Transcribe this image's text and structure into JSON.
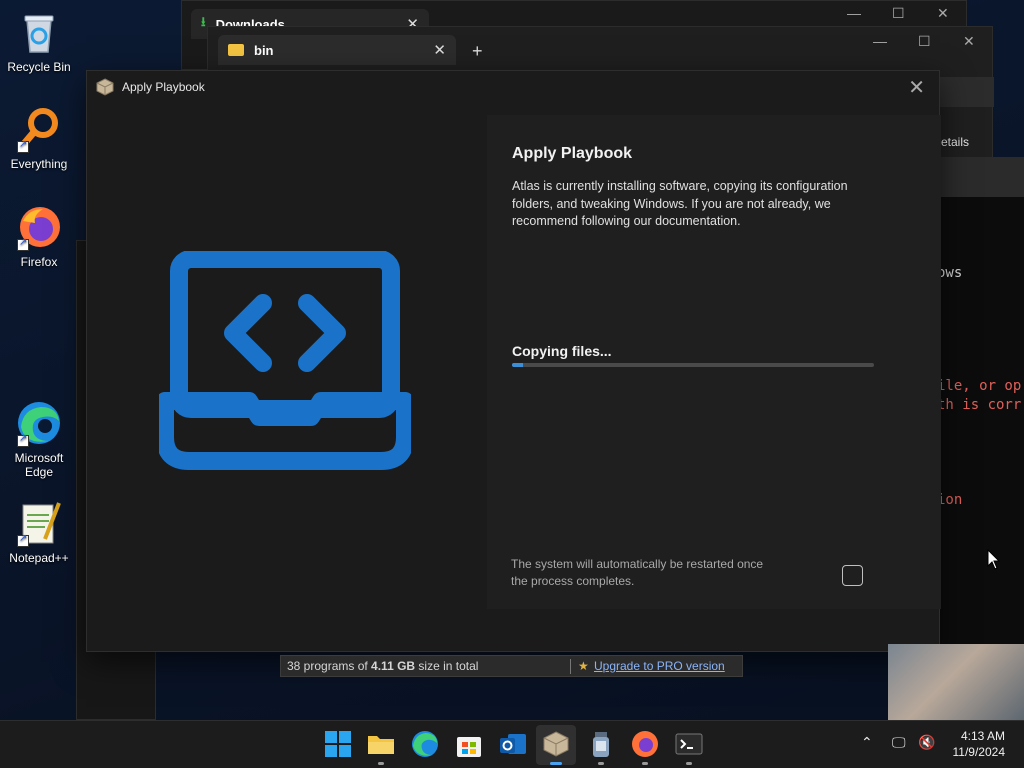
{
  "desktop": {
    "icons": [
      {
        "label": "Recycle Bin"
      },
      {
        "label": "Everything"
      },
      {
        "label": "Firefox"
      },
      {
        "label": "Microsoft Edge"
      },
      {
        "label": "Notepad++"
      }
    ]
  },
  "background_windows": {
    "downloads_tab": "Downloads",
    "bin_tab": "bin",
    "details_fragment": "etails"
  },
  "dialog": {
    "window_title": "Apply Playbook",
    "heading": "Apply Playbook",
    "description": "Atlas is currently installing software, copying its configuration folders, and tweaking Windows. If you are not already, we recommend following our documentation.",
    "status": "Copying files...",
    "progress": 0.03,
    "restart_note": "The system will automatically be restarted once the process completes.",
    "restart_checkbox_checked": false,
    "accent_color": "#1a73c8"
  },
  "everything_status": {
    "programs_text": "38 programs of ",
    "size": "4.11 GB",
    "size_suffix": " size in total",
    "upgrade_link": "Upgrade to PRO version"
  },
  "terminal": {
    "lines": [
      "ows",
      "ile, or op",
      "th is corr",
      "ion"
    ]
  },
  "taskbar": {
    "time": "4:13 AM",
    "date": "11/9/2024"
  }
}
